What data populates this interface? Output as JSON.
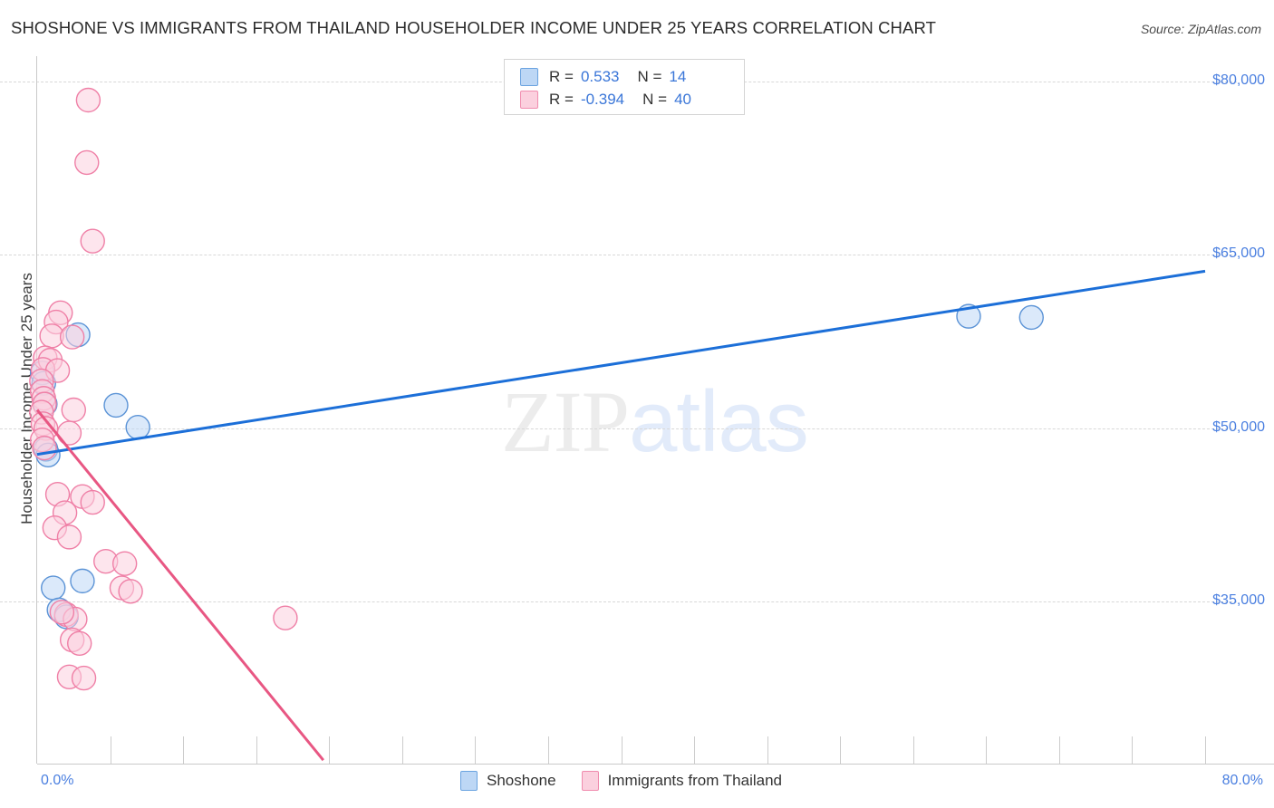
{
  "header": {
    "title": "SHOSHONE VS IMMIGRANTS FROM THAILAND HOUSEHOLDER INCOME UNDER 25 YEARS CORRELATION CHART",
    "source": "Source: ZipAtlas.com"
  },
  "watermark": {
    "part1": "ZIP",
    "part2": "atlas"
  },
  "stats_legend": {
    "rows": [
      {
        "r_label": "R =",
        "r_value": "0.533",
        "n_label": "N =",
        "n_value": "14",
        "color": "#bdd7f5"
      },
      {
        "r_label": "R =",
        "r_value": "-0.394",
        "n_label": "N =",
        "n_value": "40",
        "color": "#fbd0de"
      }
    ]
  },
  "bottom_legend": {
    "items": [
      {
        "label": "Shoshone",
        "color": "#bdd7f5"
      },
      {
        "label": "Immigrants from Thailand",
        "color": "#fbd0de"
      }
    ]
  },
  "chart_data": {
    "type": "scatter",
    "title": "SHOSHONE VS IMMIGRANTS FROM THAILAND HOUSEHOLDER INCOME UNDER 25 YEARS CORRELATION CHART",
    "xlabel": "",
    "ylabel": "Householder Income Under 25 years",
    "xlim": [
      0,
      80
    ],
    "ylim": [
      21000,
      82200
    ],
    "xticks": [
      0,
      5,
      10,
      15,
      20,
      25,
      30,
      35,
      40,
      45,
      50,
      55,
      60,
      65,
      70,
      75,
      80
    ],
    "xtick_labels": [
      "0.0%",
      "80.0%"
    ],
    "yticks": [
      80000,
      65000,
      50000,
      35000
    ],
    "ytick_labels": [
      "$80,000",
      "$65,000",
      "$50,000",
      "$35,000"
    ],
    "grid": true,
    "legend_position": "bottom-center",
    "series": [
      {
        "name": "Shoshone",
        "color": "#bdd7f5",
        "edge_color": "#5b93d6",
        "r": 0.533,
        "n": 14,
        "trendline": {
          "x0": 0,
          "y0": 47750,
          "x1": 80,
          "y1": 63600,
          "color": "#1c6fd8"
        },
        "points": [
          {
            "x": 0.35,
            "y": 54800
          },
          {
            "x": 0.45,
            "y": 53900
          },
          {
            "x": 0.55,
            "y": 52100
          },
          {
            "x": 0.6,
            "y": 48200
          },
          {
            "x": 0.75,
            "y": 47700
          },
          {
            "x": 1.1,
            "y": 36200
          },
          {
            "x": 1.5,
            "y": 34300
          },
          {
            "x": 2.0,
            "y": 33700
          },
          {
            "x": 2.8,
            "y": 58100
          },
          {
            "x": 3.1,
            "y": 36800
          },
          {
            "x": 5.4,
            "y": 52000
          },
          {
            "x": 6.9,
            "y": 50100
          },
          {
            "x": 63.8,
            "y": 59700
          },
          {
            "x": 68.1,
            "y": 59600
          }
        ]
      },
      {
        "name": "Immigrants from Thailand",
        "color": "#fbd0de",
        "edge_color": "#ef7fa6",
        "r": -0.394,
        "n": 40,
        "trendline": {
          "x0": 0,
          "y0": 51600,
          "x1": 19.6,
          "y1": 21300,
          "color": "#e85783"
        },
        "points": [
          {
            "x": 3.5,
            "y": 78400
          },
          {
            "x": 3.4,
            "y": 73000
          },
          {
            "x": 3.8,
            "y": 66200
          },
          {
            "x": 1.6,
            "y": 60000
          },
          {
            "x": 1.3,
            "y": 59200
          },
          {
            "x": 1.0,
            "y": 58000
          },
          {
            "x": 2.4,
            "y": 57900
          },
          {
            "x": 0.55,
            "y": 56100
          },
          {
            "x": 0.9,
            "y": 55900
          },
          {
            "x": 0.4,
            "y": 55100
          },
          {
            "x": 1.4,
            "y": 55000
          },
          {
            "x": 0.3,
            "y": 54100
          },
          {
            "x": 0.35,
            "y": 53200
          },
          {
            "x": 0.45,
            "y": 52600
          },
          {
            "x": 0.5,
            "y": 52100
          },
          {
            "x": 0.3,
            "y": 51400
          },
          {
            "x": 2.5,
            "y": 51600
          },
          {
            "x": 0.4,
            "y": 50400
          },
          {
            "x": 0.6,
            "y": 50000
          },
          {
            "x": 2.2,
            "y": 49600
          },
          {
            "x": 0.35,
            "y": 49000
          },
          {
            "x": 0.5,
            "y": 48300
          },
          {
            "x": 1.4,
            "y": 44300
          },
          {
            "x": 3.1,
            "y": 44100
          },
          {
            "x": 3.8,
            "y": 43600
          },
          {
            "x": 1.9,
            "y": 42700
          },
          {
            "x": 1.2,
            "y": 41400
          },
          {
            "x": 2.2,
            "y": 40600
          },
          {
            "x": 4.7,
            "y": 38500
          },
          {
            "x": 6.0,
            "y": 38300
          },
          {
            "x": 5.8,
            "y": 36200
          },
          {
            "x": 6.4,
            "y": 35900
          },
          {
            "x": 17.0,
            "y": 33600
          },
          {
            "x": 2.0,
            "y": 33900
          },
          {
            "x": 2.6,
            "y": 33500
          },
          {
            "x": 2.4,
            "y": 31700
          },
          {
            "x": 2.9,
            "y": 31400
          },
          {
            "x": 2.2,
            "y": 28500
          },
          {
            "x": 3.2,
            "y": 28400
          },
          {
            "x": 1.7,
            "y": 34100
          }
        ]
      }
    ]
  }
}
